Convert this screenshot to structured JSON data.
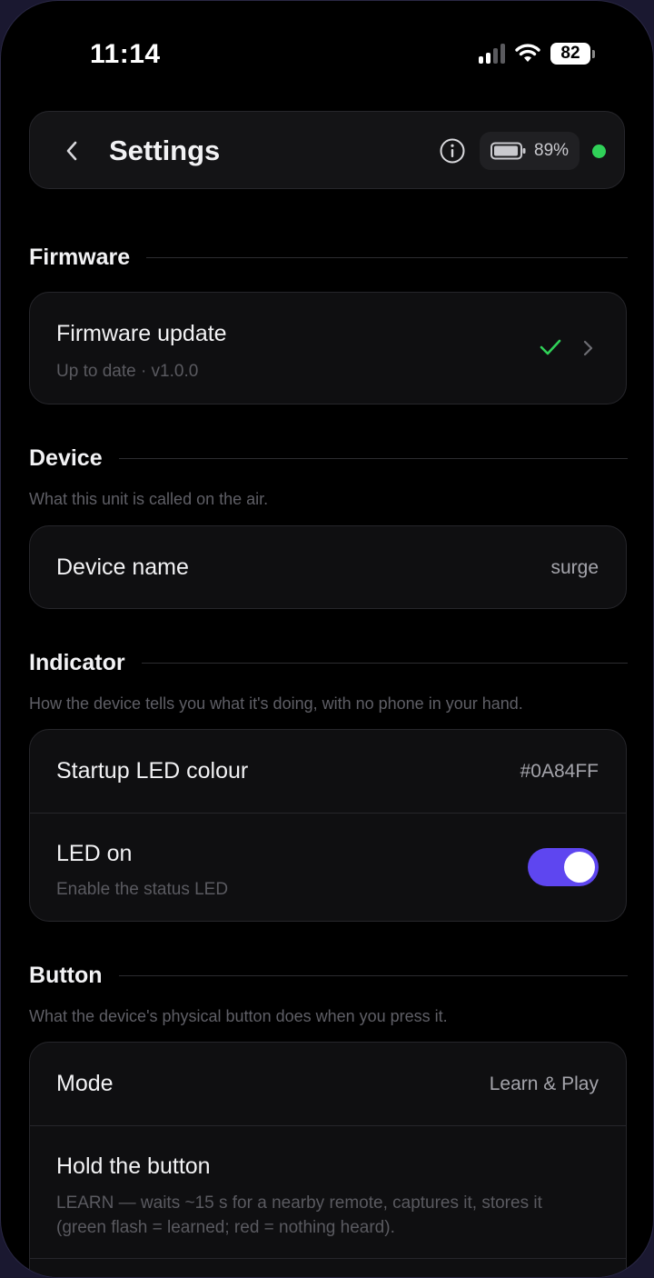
{
  "status_bar": {
    "time": "11:14",
    "battery": "82"
  },
  "header": {
    "title": "Settings",
    "device_battery": "89%",
    "connection_color": "#30d158"
  },
  "sections": {
    "firmware": {
      "title": "Firmware",
      "rows": {
        "update_title": "Firmware update",
        "update_sub": "Up to date · v1.0.0"
      }
    },
    "device": {
      "title": "Device",
      "description": "What this unit is called on the air.",
      "rows": {
        "name_title": "Device name",
        "name_value": "surge"
      }
    },
    "indicator": {
      "title": "Indicator",
      "description": "How the device tells you what it's doing, with no phone in your hand.",
      "rows": {
        "led_colour_title": "Startup LED colour",
        "led_colour_value": "#0A84FF",
        "led_on_title": "LED on",
        "led_on_sub": "Enable the status LED",
        "led_on_state": true
      }
    },
    "button": {
      "title": "Button",
      "description": "What the device's physical button does when you press it.",
      "rows": {
        "mode_title": "Mode",
        "mode_value": "Learn & Play",
        "hold_title": "Hold the button",
        "hold_sub_line1": "LEARN — waits ~15 s for a nearby remote, captures it, stores it",
        "hold_sub_line2": "(green flash = learned; red = nothing heard)."
      }
    }
  },
  "colors": {
    "accent": "#5e46f0",
    "success": "#30d158"
  }
}
